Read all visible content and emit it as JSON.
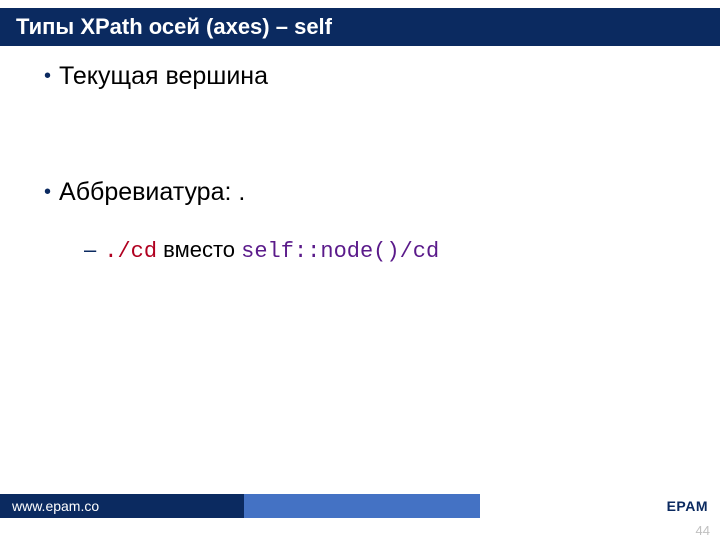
{
  "title": "Типы XPath осей (axes) – self",
  "bullets": [
    {
      "text": "Текущая вершина"
    },
    {
      "text": "Аббревиатура: ."
    }
  ],
  "sub": {
    "code1": "./cd",
    "mid": " вместо ",
    "code2": "self::node()/cd"
  },
  "footer": {
    "url": "www.epam.co",
    "brand": "EPAM"
  },
  "page": "44"
}
